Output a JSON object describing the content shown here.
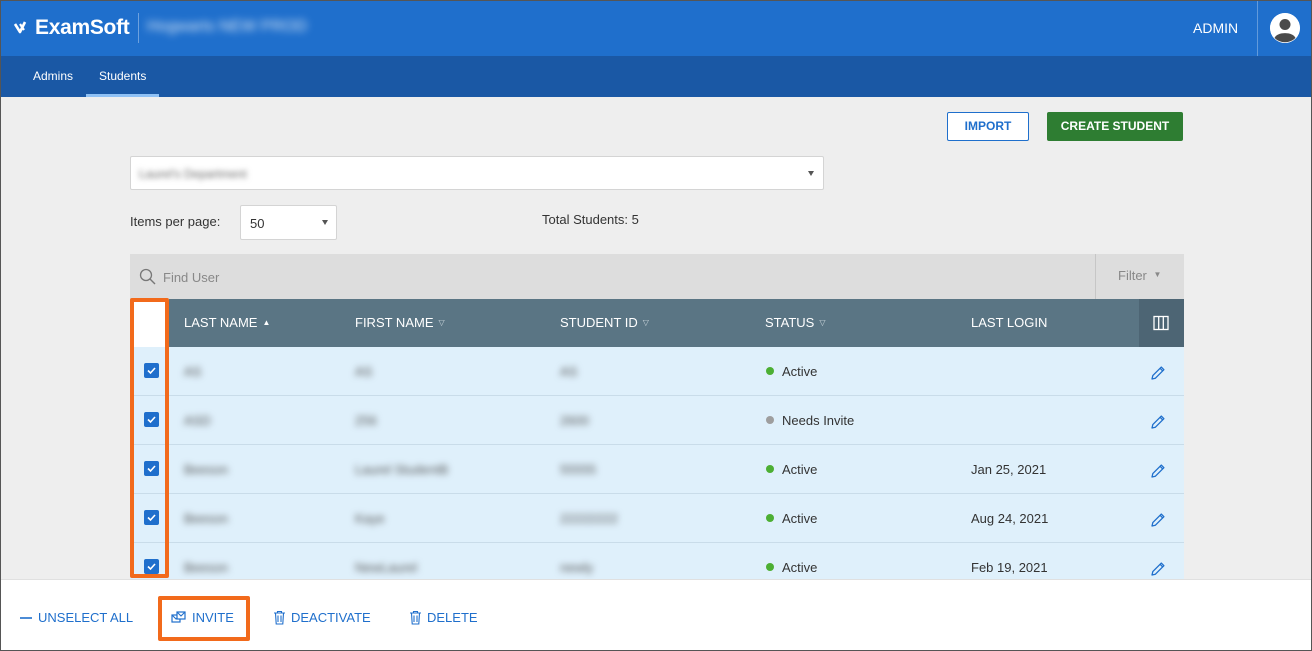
{
  "header": {
    "brand": "ExamSoft",
    "org_name": "Hogwarts NEW PROD",
    "user_label": "ADMIN"
  },
  "nav": {
    "tabs": [
      {
        "label": "Admins"
      },
      {
        "label": "Students",
        "active": true
      }
    ]
  },
  "toolbar": {
    "import_label": "IMPORT",
    "create_label": "CREATE STUDENT"
  },
  "department": {
    "value": "Laurel's Department"
  },
  "pagination": {
    "items_label": "Items per page:",
    "items_value": "50",
    "total_label": "Total Students: 5"
  },
  "search": {
    "placeholder": "Find User",
    "filter_label": "Filter"
  },
  "table": {
    "columns": [
      {
        "label": "LAST NAME",
        "sort": "asc"
      },
      {
        "label": "FIRST NAME",
        "sort": "none"
      },
      {
        "label": "STUDENT ID",
        "sort": "none"
      },
      {
        "label": "STATUS",
        "sort": "none"
      },
      {
        "label": "LAST LOGIN",
        "sort": null
      }
    ],
    "rows": [
      {
        "last": "AS",
        "first": "AS",
        "id": "AS",
        "status": "Active",
        "status_color": "#4caf33",
        "last_login": "",
        "checked": true
      },
      {
        "last": "ASD",
        "first": "256",
        "id": "2600",
        "status": "Needs Invite",
        "status_color": "#9e9e9e",
        "last_login": "",
        "checked": true
      },
      {
        "last": "Beeson",
        "first": "Laurel StudentB",
        "id": "55555",
        "status": "Active",
        "status_color": "#4caf33",
        "last_login": "Jan 25, 2021",
        "checked": true
      },
      {
        "last": "Beeson",
        "first": "Kaye",
        "id": "22222222",
        "status": "Active",
        "status_color": "#4caf33",
        "last_login": "Aug 24, 2021",
        "checked": true
      },
      {
        "last": "Beeson",
        "first": "NewLaurel",
        "id": "newly",
        "status": "Active",
        "status_color": "#4caf33",
        "last_login": "Feb 19, 2021",
        "checked": true
      }
    ]
  },
  "actions": {
    "unselect_all": "UNSELECT ALL",
    "invite": "INVITE",
    "deactivate": "DEACTIVATE",
    "delete": "DELETE"
  },
  "colors": {
    "brand_blue": "#1f6fcc",
    "nav_blue": "#1a58a5",
    "create_green": "#2e7d32",
    "table_header": "#5a7584",
    "row_bg": "#dff0fb",
    "highlight": "#f26a1b"
  }
}
